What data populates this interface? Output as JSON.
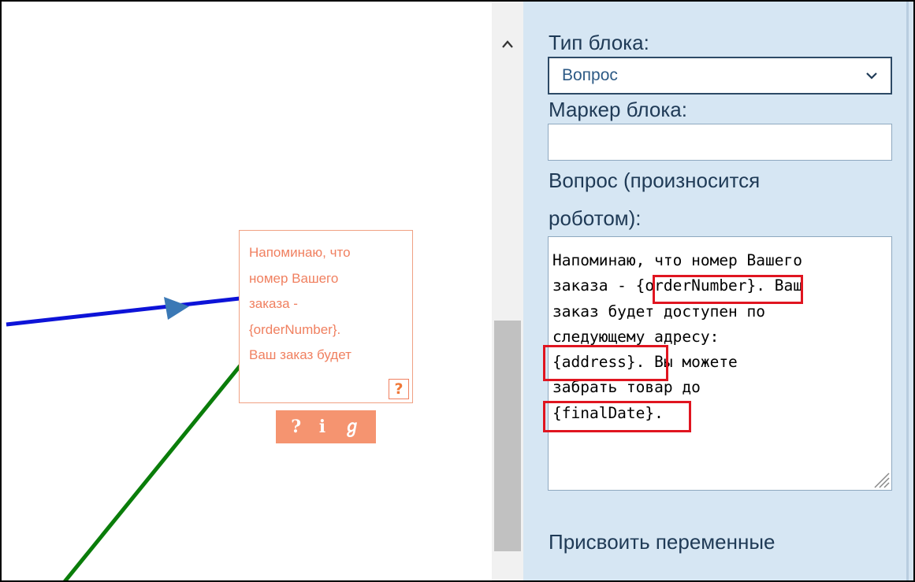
{
  "canvas": {
    "node": {
      "text": "Напоминаю, что\nномер Вашего\nзаказа -\n{orderNumber}.\nВаш заказ будет",
      "help_label": "?"
    },
    "toolbar": {
      "help_label": "?",
      "info_label": "i",
      "branch_label": "ℊ"
    },
    "colors": {
      "incoming_edge": "#0d13d8",
      "outgoing_edge": "#0a7d0a",
      "arrow": "#3a78b5",
      "node_text": "#f08060",
      "toolbar_bg": "#f59470"
    }
  },
  "scrollbar": {
    "up_icon": "chevron-up-icon"
  },
  "panel": {
    "block_type_label": "Тип блока:",
    "block_type_value": "Вопрос",
    "block_marker_label": "Маркер блока:",
    "block_marker_value": "",
    "question_label_line1": "Вопрос (произносится",
    "question_label_line2": "роботом):",
    "question_text": "Напоминаю, что номер Вашего\nзаказа - {orderNumber}. Ваш\nзаказ будет доступен по\nследующему адресу:\n{address}. Вы можете\nзабрать товар до\n{finalDate}.",
    "assign_vars_label": "Присвоить переменные",
    "highlighted_variables": [
      "{orderNumber}",
      "{address}",
      "{finalDate}"
    ],
    "colors": {
      "panel_bg": "#d6e6f3",
      "label": "#1f3a56",
      "highlight": "#e01520"
    }
  }
}
